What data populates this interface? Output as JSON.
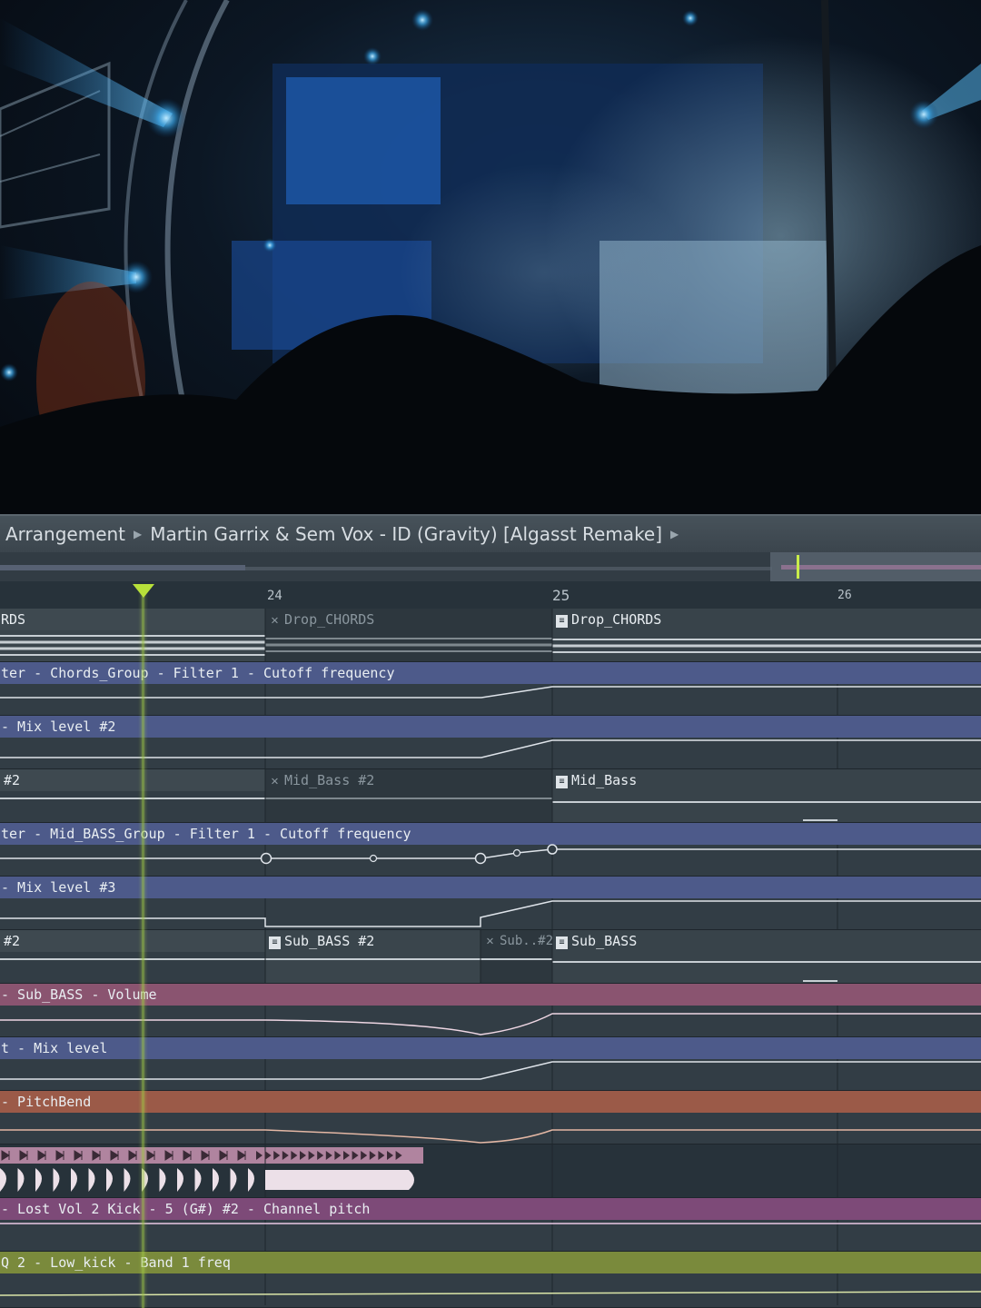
{
  "breadcrumb": {
    "items": [
      "Arrangement",
      "Martin Garrix & Sem Vox - ID (Gravity) [Algasst Remake]"
    ]
  },
  "ruler": {
    "bars": [
      "24",
      "25",
      "26"
    ]
  },
  "colors": {
    "pattern_track": "#3a454d",
    "automation_blue": "#4d5a8a",
    "automation_pink": "#8a5470",
    "automation_orange": "#9b5a48",
    "automation_magenta": "#7d4a78",
    "automation_olive": "#7a8a3c",
    "playhead": "#b7e03a"
  },
  "tracks": [
    {
      "type": "pattern",
      "label": "RDS",
      "clips": [
        {
          "label": "Drop_CHORDS",
          "state": "muted",
          "icon": "x-icon"
        },
        {
          "label": "Drop_CHORDS",
          "state": "active",
          "icon": "pattern-icon"
        }
      ]
    },
    {
      "type": "automation",
      "color": "blue",
      "label": "ter - Chords_Group - Filter 1 - Cutoff frequency"
    },
    {
      "type": "automation",
      "color": "blue",
      "label": "- Mix level #2"
    },
    {
      "type": "pattern",
      "label": "#2",
      "clips": [
        {
          "label": "Mid_Bass #2",
          "state": "muted",
          "icon": "x-icon"
        },
        {
          "label": "Mid_Bass",
          "state": "active",
          "icon": "pattern-icon"
        }
      ]
    },
    {
      "type": "automation",
      "color": "blue",
      "label": "ter - Mid_BASS_Group - Filter 1 - Cutoff frequency"
    },
    {
      "type": "automation",
      "color": "blue",
      "label": "- Mix level #3"
    },
    {
      "type": "pattern",
      "label": "#2",
      "clips": [
        {
          "label": "Sub_BASS #2",
          "state": "active",
          "icon": "pattern-icon"
        },
        {
          "label": "Sub..#2",
          "state": "muted",
          "icon": "x-icon"
        },
        {
          "label": "Sub_BASS",
          "state": "active",
          "icon": "pattern-icon"
        }
      ]
    },
    {
      "type": "automation",
      "color": "pink",
      "label": "- Sub_BASS - Volume"
    },
    {
      "type": "automation",
      "color": "blue",
      "label": "t - Mix level"
    },
    {
      "type": "automation",
      "color": "orange",
      "label": "- PitchBend"
    },
    {
      "type": "audio",
      "label": ""
    },
    {
      "type": "automation",
      "color": "magenta",
      "label": "- Lost Vol 2 Kick - 5 (G#) #2 - Channel pitch"
    },
    {
      "type": "automation",
      "color": "olive",
      "label": "Q 2 - Low_kick - Band 1 freq"
    }
  ]
}
